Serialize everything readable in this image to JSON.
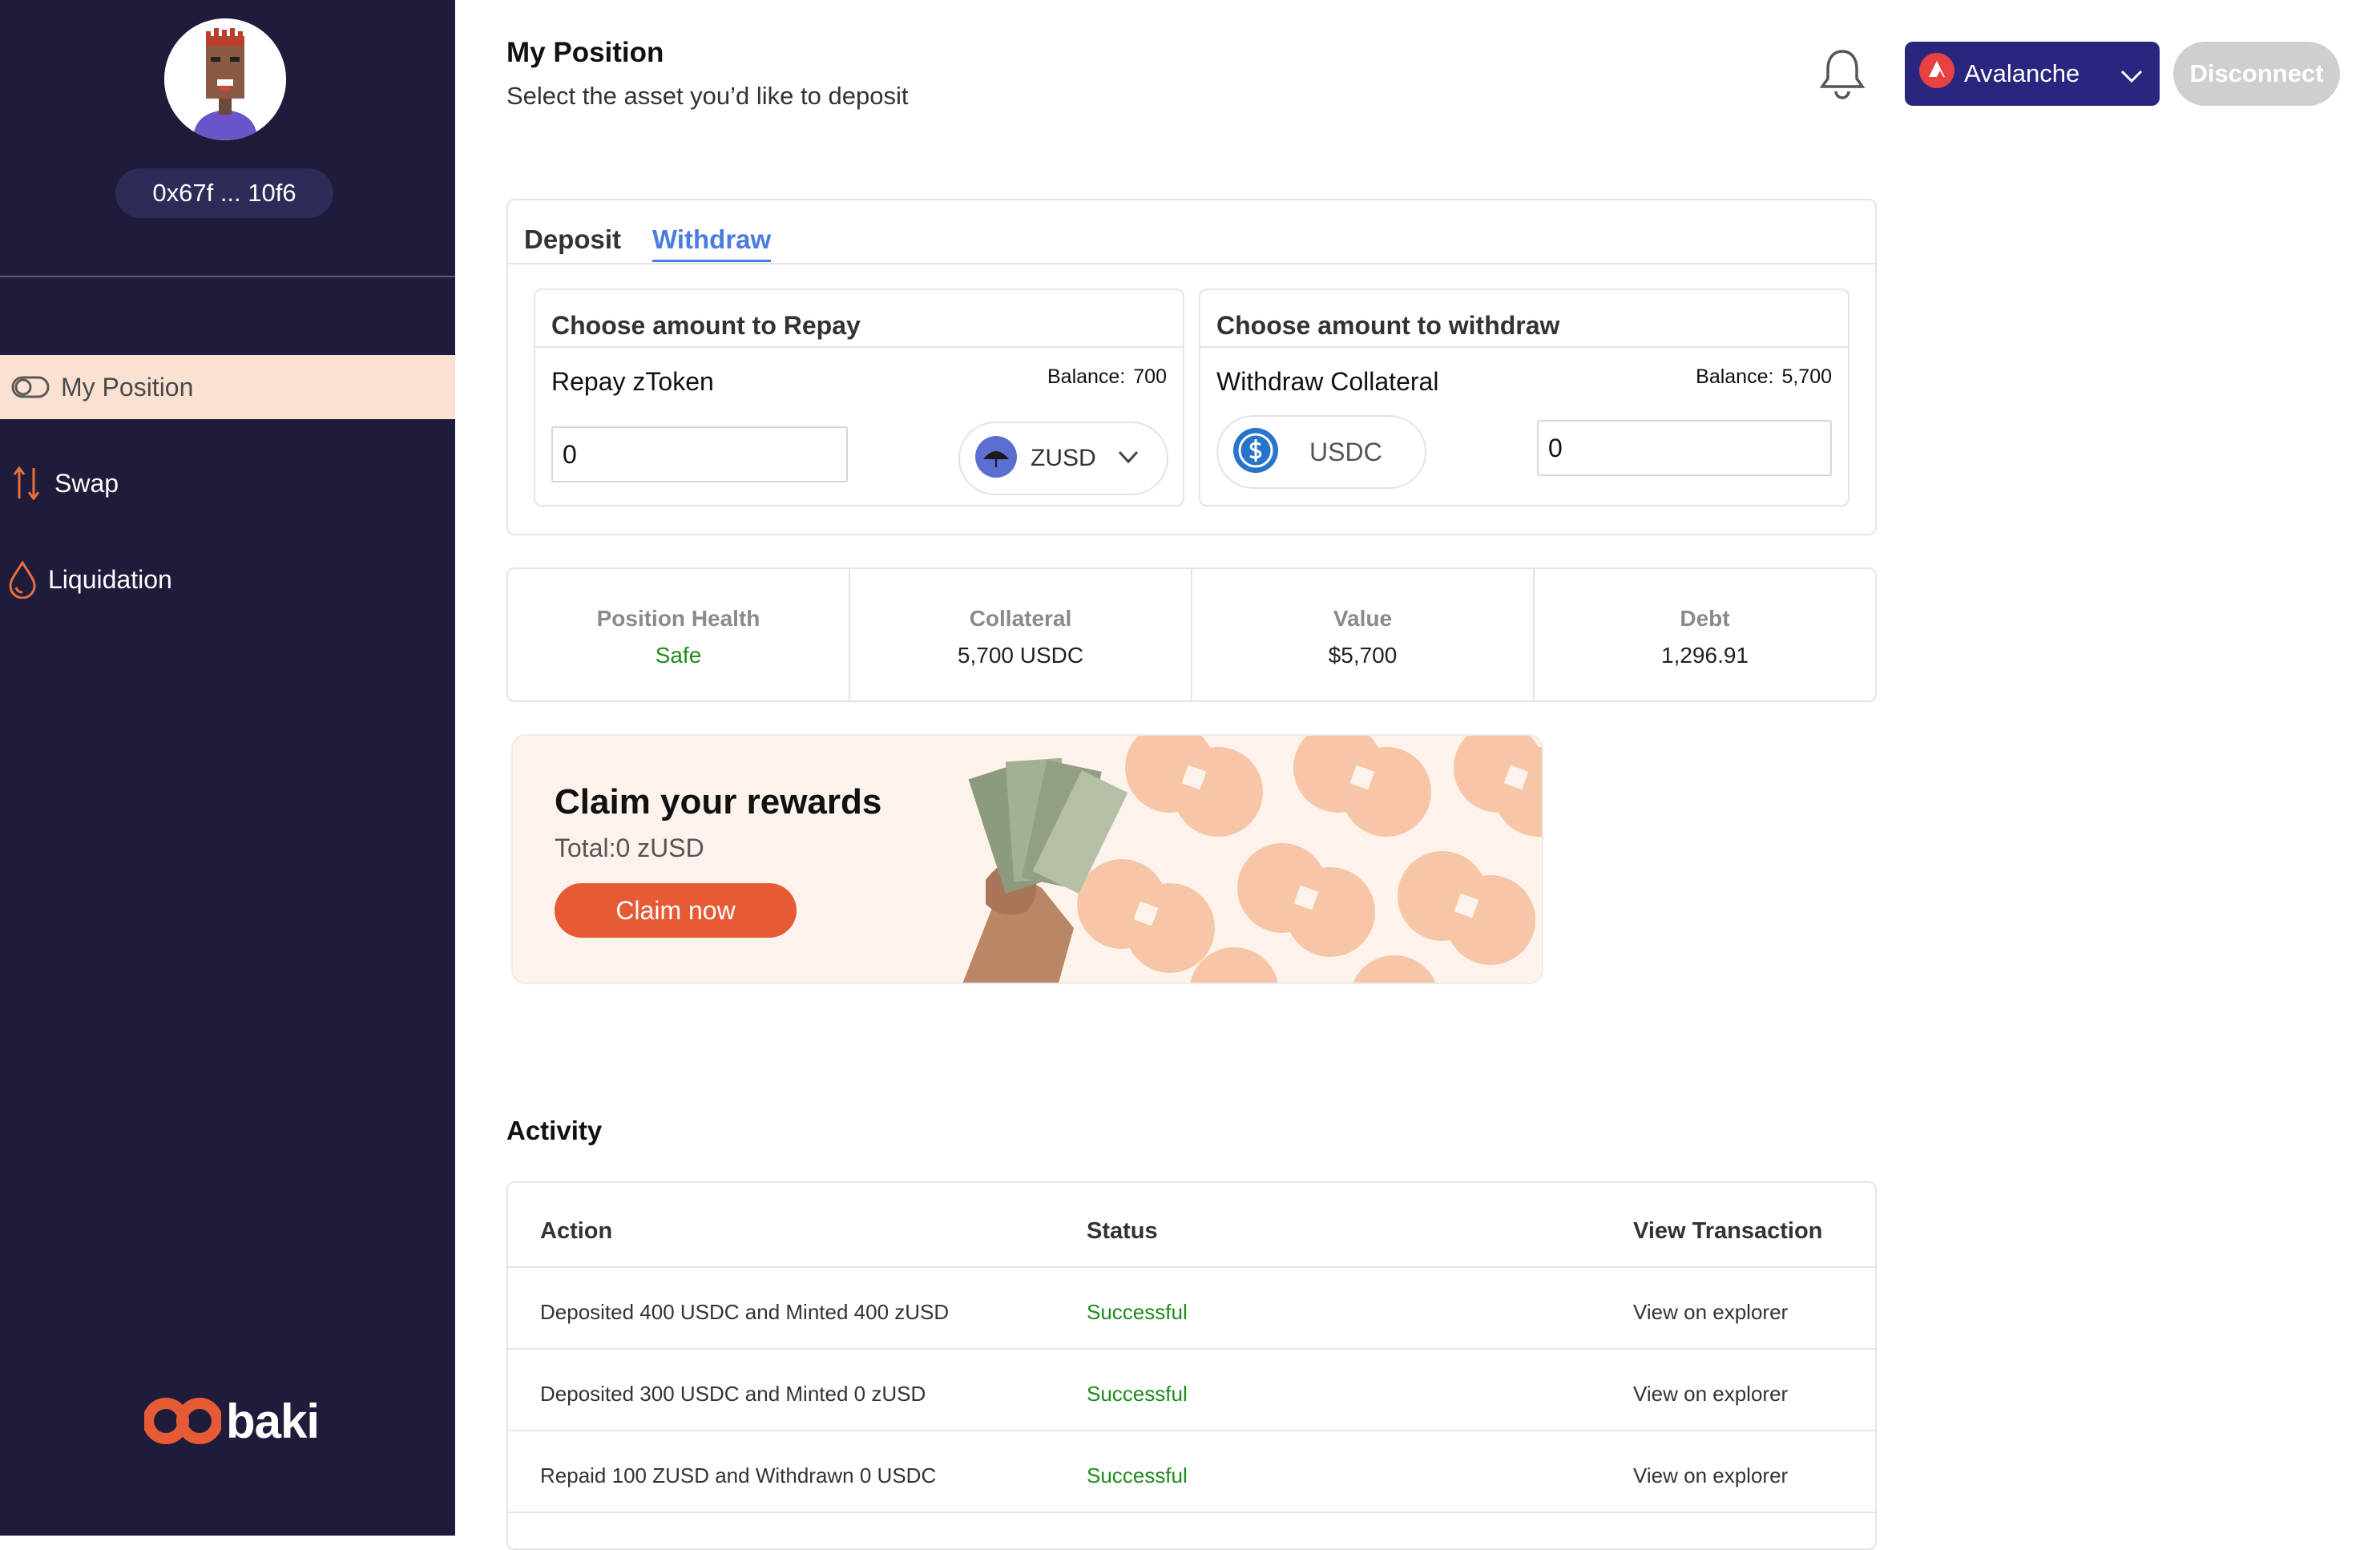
{
  "sidebar": {
    "wallet_address": "0x67f ... 10f6",
    "nav": [
      {
        "label": "My Position",
        "icon": "toggle-icon",
        "active": true
      },
      {
        "label": "Swap",
        "icon": "swap-arrows-icon",
        "active": false
      },
      {
        "label": "Liquidation",
        "icon": "drop-icon",
        "active": false
      }
    ],
    "logo_text": "baki"
  },
  "header": {
    "title": "My Position",
    "subtitle": "Select the asset you’d like to deposit",
    "network": "Avalanche",
    "disconnect_label": "Disconnect"
  },
  "tabs": {
    "deposit": "Deposit",
    "withdraw": "Withdraw",
    "active": "Withdraw"
  },
  "repay": {
    "title": "Choose amount to Repay",
    "label": "Repay zToken",
    "balance_label": "Balance:",
    "balance_value": "700",
    "amount": "0",
    "token": "ZUSD"
  },
  "withdraw": {
    "title": "Choose amount to withdraw",
    "label": "Withdraw Collateral",
    "balance_label": "Balance:",
    "balance_value": "5,700",
    "amount": "0",
    "token": "USDC"
  },
  "stats": [
    {
      "label": "Position Health",
      "value": "Safe"
    },
    {
      "label": "Collateral",
      "value": "5,700 USDC"
    },
    {
      "label": "Value",
      "value": "$5,700"
    },
    {
      "label": "Debt",
      "value": "1,296.91"
    }
  ],
  "rewards": {
    "title": "Claim your rewards",
    "total": "Total:0 zUSD",
    "button": "Claim now"
  },
  "activity": {
    "title": "Activity",
    "columns": [
      "Action",
      "Status",
      "View Transaction"
    ],
    "rows": [
      {
        "action": "Deposited 400 USDC and Minted 400 zUSD",
        "status": "Successful",
        "link": "View on explorer"
      },
      {
        "action": "Deposited 300 USDC and Minted 0 zUSD",
        "status": "Successful",
        "link": "View on explorer"
      },
      {
        "action": "Repaid 100 ZUSD and Withdrawn 0 USDC",
        "status": "Successful",
        "link": "View on explorer"
      }
    ]
  },
  "colors": {
    "sidebar_bg": "#1e1c3a",
    "active_nav_bg": "#fbe1d1",
    "accent_orange": "#e65b35",
    "network_btn": "#2a2680",
    "tab_active": "#4a7be0",
    "success": "#1e8a1e"
  }
}
